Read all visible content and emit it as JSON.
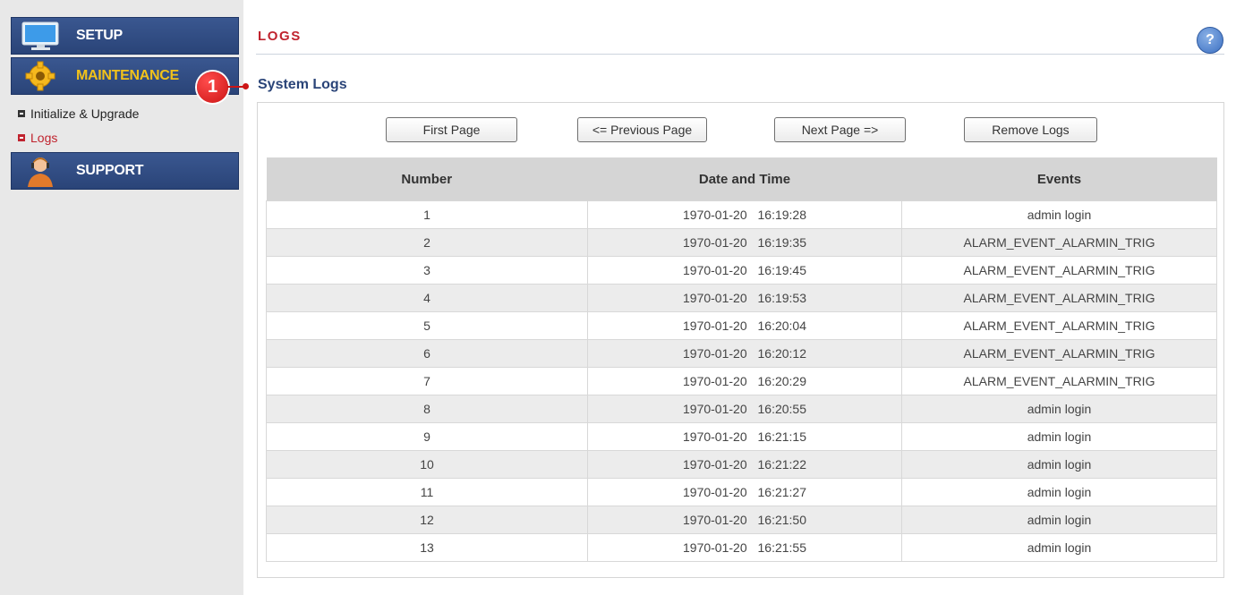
{
  "sidebar": {
    "setup": {
      "label": "SETUP",
      "icon": "monitor-icon"
    },
    "maintenance": {
      "label": "MAINTENANCE",
      "icon": "gear-icon"
    },
    "sub_items": [
      {
        "label": "Initialize & Upgrade"
      },
      {
        "label": "Logs"
      }
    ],
    "support": {
      "label": "SUPPORT",
      "icon": "support-person-icon"
    }
  },
  "callout": {
    "number": "1"
  },
  "header": {
    "title": "LOGS",
    "help": "?"
  },
  "section": {
    "title": "System Logs"
  },
  "buttons": {
    "first": "First Page",
    "previous": "<= Previous Page",
    "next": "Next Page =>",
    "remove": "Remove Logs"
  },
  "table": {
    "columns": [
      "Number",
      "Date and Time",
      "Events"
    ],
    "rows": [
      {
        "number": "1",
        "datetime": "1970-01-20 16:19:28",
        "event": "admin login"
      },
      {
        "number": "2",
        "datetime": "1970-01-20 16:19:35",
        "event": "ALARM_EVENT_ALARMIN_TRIG"
      },
      {
        "number": "3",
        "datetime": "1970-01-20 16:19:45",
        "event": "ALARM_EVENT_ALARMIN_TRIG"
      },
      {
        "number": "4",
        "datetime": "1970-01-20 16:19:53",
        "event": "ALARM_EVENT_ALARMIN_TRIG"
      },
      {
        "number": "5",
        "datetime": "1970-01-20 16:20:04",
        "event": "ALARM_EVENT_ALARMIN_TRIG"
      },
      {
        "number": "6",
        "datetime": "1970-01-20 16:20:12",
        "event": "ALARM_EVENT_ALARMIN_TRIG"
      },
      {
        "number": "7",
        "datetime": "1970-01-20 16:20:29",
        "event": "ALARM_EVENT_ALARMIN_TRIG"
      },
      {
        "number": "8",
        "datetime": "1970-01-20 16:20:55",
        "event": "admin login"
      },
      {
        "number": "9",
        "datetime": "1970-01-20 16:21:15",
        "event": "admin login"
      },
      {
        "number": "10",
        "datetime": "1970-01-20 16:21:22",
        "event": "admin login"
      },
      {
        "number": "11",
        "datetime": "1970-01-20 16:21:27",
        "event": "admin login"
      },
      {
        "number": "12",
        "datetime": "1970-01-20 16:21:50",
        "event": "admin login"
      },
      {
        "number": "13",
        "datetime": "1970-01-20 16:21:55",
        "event": "admin login"
      }
    ]
  },
  "colors": {
    "nav_bg": "#2a4478",
    "active_label": "#f2c21a",
    "accent_red": "#c0232e",
    "section_title": "#2a4478",
    "header_row": "#d5d5d5"
  }
}
